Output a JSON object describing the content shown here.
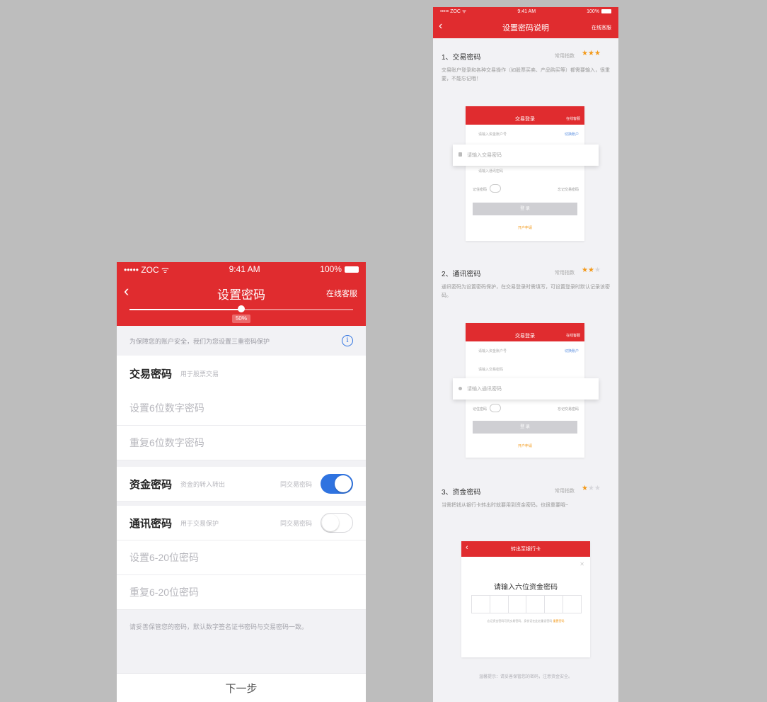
{
  "colors": {
    "brand_red": "#e02c2f",
    "toggle_on": "#2f73e0",
    "star": "#f39a1b",
    "background": "#bdbdbd"
  },
  "left": {
    "status": {
      "carrier": "••••• ZOC ᯤ",
      "time": "9:41 AM",
      "battery": "100%"
    },
    "nav": {
      "back_icon": "chevron-left-icon",
      "title": "设置密码",
      "right": "在线客服"
    },
    "progress": {
      "value": 0.5,
      "label": "50%"
    },
    "notice": {
      "text": "为保障您的账户安全，我们为您设置三重密码保护",
      "icon": "info-icon"
    },
    "trade": {
      "title": "交易密码",
      "hint": "用于股票交易",
      "input1_placeholder": "设置6位数字密码",
      "input2_placeholder": "重复6位数字密码"
    },
    "fund": {
      "title": "资金密码",
      "hint": "资金的转入转出",
      "toggle_label": "同交易密码",
      "toggle_on": true
    },
    "comm": {
      "title": "通讯密码",
      "hint": "用于交易保护",
      "toggle_label": "同交易密码",
      "toggle_on": false,
      "input1_placeholder": "设置6-20位密码",
      "input2_placeholder": "重复6-20位密码"
    },
    "footer_note": "请妥善保管您的密码，默认数字签名证书密码与交易密码一致。",
    "next_button": "下一步"
  },
  "right": {
    "status": {
      "carrier": "••••• ZOC ᯤ",
      "time": "9:41 AM",
      "battery": "100%"
    },
    "nav": {
      "back_icon": "chevron-left-icon",
      "title": "设置密码说明",
      "right": "在线客服"
    },
    "sections": [
      {
        "title": "1、交易密码",
        "freq_label": "常用指数",
        "stars": 3,
        "desc": "交易账户登录和各种交易操作（如股票买卖、产品购买等）都需要输入，很重要，不能忘记哦！"
      },
      {
        "title": "2、通讯密码",
        "freq_label": "常用指数",
        "stars": 2,
        "desc": "通讯密码为设置密码保护，在交易登录时需填写，可设置登录时默认记录该密码。"
      },
      {
        "title": "3、资金密码",
        "freq_label": "常用指数",
        "stars": 1,
        "desc": "当需把钱从银行卡转出时就要用到资金密码，也很重要哦~"
      }
    ],
    "mock1": {
      "title": "交易登录",
      "right": "在线客服",
      "field1": "请输入资金账户号",
      "field1_link": "切换账户",
      "highlight": "请输入交易密码",
      "field3": "请输入通讯密码",
      "remember": "记住密码",
      "forgot": "忘记交易密码",
      "button": "登 录",
      "link": "开户申请"
    },
    "mock2": {
      "title": "交易登录",
      "right": "在线客服",
      "field1": "请输入资金账户号",
      "field1_link": "切换账户",
      "field2": "请输入交易密码",
      "highlight": "请输入通讯密码",
      "remember": "记住密码",
      "forgot": "忘记交易密码",
      "button": "登 录",
      "link": "开户申请"
    },
    "mock3": {
      "title": "转出至银行卡",
      "close_icon": "close-icon",
      "heading": "请输入六位资金密码",
      "tip": "忘记资金密码可凭交易密码、身份证在此处重设密码",
      "tip_link": "重置密码"
    },
    "bottom_note": "温馨提示：请妥善保管您的密码，注意资金安全。"
  }
}
